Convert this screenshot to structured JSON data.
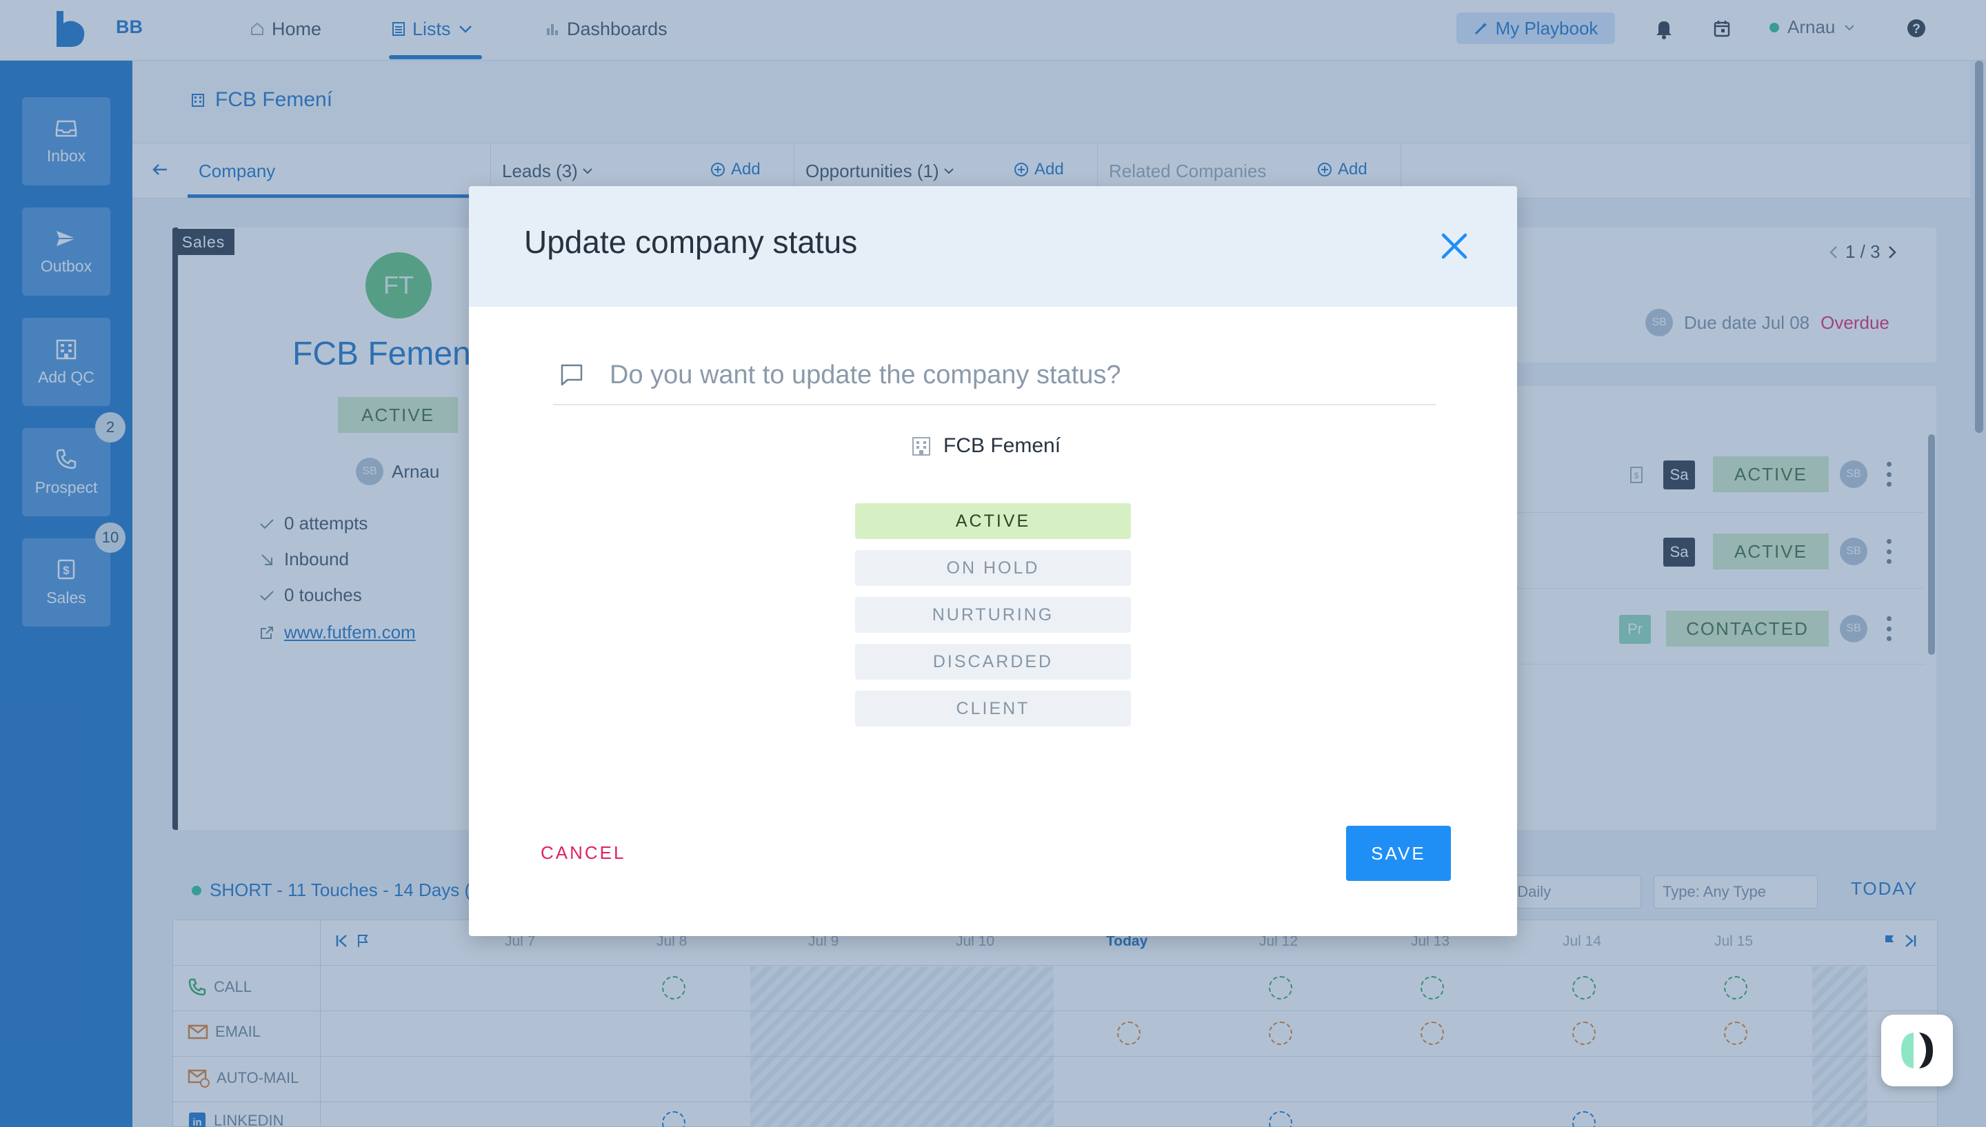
{
  "app": {
    "brand": "BB"
  },
  "nav": {
    "home": "Home",
    "lists": "Lists",
    "dashboards": "Dashboards",
    "playbook": "My Playbook",
    "user_name": "Arnau"
  },
  "sidebar": {
    "items": [
      {
        "label": "Inbox",
        "badge": ""
      },
      {
        "label": "Outbox",
        "badge": ""
      },
      {
        "label": "Add QC",
        "badge": ""
      },
      {
        "label": "Prospect",
        "badge": "2"
      },
      {
        "label": "Sales",
        "badge": "10"
      }
    ]
  },
  "page": {
    "title": "FCB Femení",
    "tabs": {
      "company": "Company",
      "leads": "Leads (3)",
      "opportunities": "Opportunities (1)",
      "related": "Related Companies",
      "add": "Add"
    }
  },
  "company_card": {
    "stage_tag": "Sales",
    "initials": "FT",
    "name": "FCB Femení",
    "status": "ACTIVE",
    "owner_initials": "SB",
    "owner": "Arnau",
    "attempts": "0 attempts",
    "source": "Inbound",
    "touches": "0 touches",
    "website": "www.futfem.com"
  },
  "right_panel": {
    "pager": "1 / 3",
    "due_initials": "SB",
    "due_date": "Due date Jul 08",
    "overdue": "Overdue",
    "leads": [
      {
        "tag": "Sa",
        "status": "ACTIVE",
        "initials": "SB"
      },
      {
        "tag": "Sa",
        "status": "ACTIVE",
        "initials": "SB"
      },
      {
        "tag": "Pr",
        "status": "CONTACTED",
        "initials": "SB"
      }
    ]
  },
  "cadence": {
    "name": "SHORT - 11 Touches - 14 Days (",
    "show": "Show: Daily",
    "type": "Type: Any Type",
    "today_button": "TODAY",
    "columns": [
      "Jul 7",
      "Jul 8",
      "Jul 9",
      "Jul 10",
      "Today",
      "Jul 12",
      "Jul 13",
      "Jul 14",
      "Jul 15"
    ],
    "rows": [
      "CALL",
      "EMAIL",
      "AUTO-MAIL",
      "LINKEDIN"
    ]
  },
  "modal": {
    "title": "Update company status",
    "question": "Do you want to update the company status?",
    "company": "FCB Femení",
    "statuses": [
      "ACTIVE",
      "ON HOLD",
      "NURTURING",
      "DISCARDED",
      "CLIENT"
    ],
    "selected_status": "ACTIVE",
    "cancel": "CANCEL",
    "save": "SAVE"
  },
  "colors": {
    "primary": "#1d72c9",
    "save": "#1f8ff5",
    "cancel": "#e0225f",
    "selected_status": "#d7f0c3",
    "overdue": "#e1266b"
  }
}
